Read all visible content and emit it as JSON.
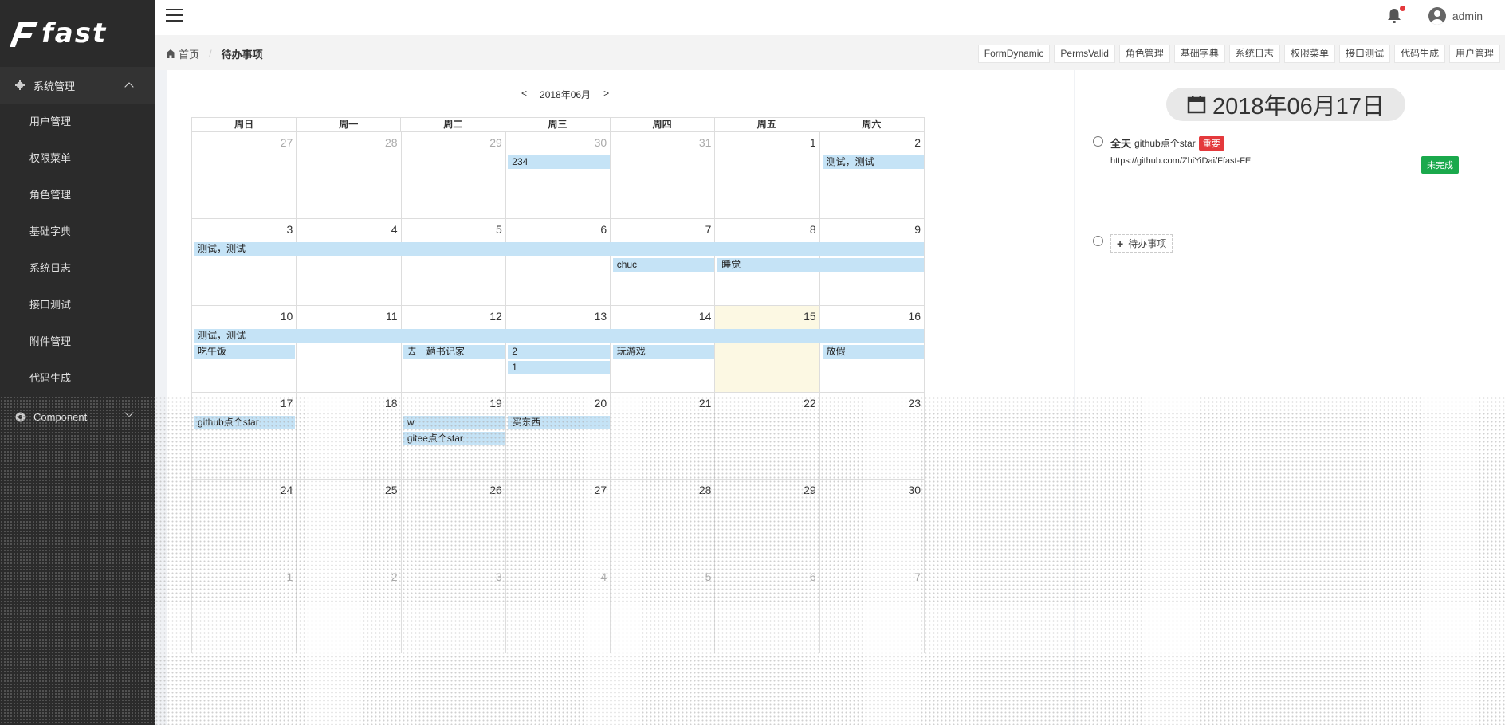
{
  "app": {
    "logo_text": "fast"
  },
  "sidebar": {
    "group1": {
      "label": "系统管理",
      "items": [
        {
          "label": "用户管理"
        },
        {
          "label": "权限菜单"
        },
        {
          "label": "角色管理"
        },
        {
          "label": "基础字典"
        },
        {
          "label": "系统日志"
        },
        {
          "label": "接口测试"
        },
        {
          "label": "附件管理"
        },
        {
          "label": "代码生成"
        }
      ]
    },
    "group2": {
      "label": "Component"
    }
  },
  "header": {
    "user": "admin",
    "has_notification": true
  },
  "breadcrumb": {
    "home": "首页",
    "separator": "/",
    "current": "待办事项"
  },
  "tags": [
    "FormDynamic",
    "PermsValid",
    "角色管理",
    "基础字典",
    "系统日志",
    "权限菜单",
    "接口测试",
    "代码生成",
    "用户管理"
  ],
  "calendar": {
    "prev": "<",
    "next": ">",
    "month_label": "2018年06月",
    "weekdays": [
      "周日",
      "周一",
      "周二",
      "周三",
      "周四",
      "周五",
      "周六"
    ],
    "weeks": [
      {
        "days": [
          {
            "n": "27",
            "other": true
          },
          {
            "n": "28",
            "other": true
          },
          {
            "n": "29",
            "other": true
          },
          {
            "n": "30",
            "other": true
          },
          {
            "n": "31",
            "other": true
          },
          {
            "n": "1"
          },
          {
            "n": "2"
          }
        ],
        "events": [
          {
            "text": "234",
            "col": 3,
            "span": 1,
            "row": 0
          },
          {
            "text": "测试，测试",
            "col": 6,
            "span": 1,
            "row": 0
          }
        ]
      },
      {
        "days": [
          {
            "n": "3"
          },
          {
            "n": "4"
          },
          {
            "n": "5"
          },
          {
            "n": "6"
          },
          {
            "n": "7"
          },
          {
            "n": "8"
          },
          {
            "n": "9"
          }
        ],
        "events": [
          {
            "text": "测试，测试",
            "col": 0,
            "span": 7,
            "row": 0
          },
          {
            "text": "chuc",
            "col": 4,
            "span": 1,
            "row": 1
          },
          {
            "text": "睡觉",
            "col": 5,
            "span": 2,
            "row": 1
          }
        ]
      },
      {
        "days": [
          {
            "n": "10"
          },
          {
            "n": "11"
          },
          {
            "n": "12"
          },
          {
            "n": "13"
          },
          {
            "n": "14"
          },
          {
            "n": "15",
            "today": true
          },
          {
            "n": "16"
          }
        ],
        "events": [
          {
            "text": "测试，测试",
            "col": 0,
            "span": 7,
            "row": 0
          },
          {
            "text": "吃午饭",
            "col": 0,
            "span": 1,
            "row": 1
          },
          {
            "text": "去一趟书记家",
            "col": 2,
            "span": 1,
            "row": 1
          },
          {
            "text": "2",
            "col": 3,
            "span": 1,
            "row": 1
          },
          {
            "text": "玩游戏",
            "col": 4,
            "span": 1,
            "row": 1
          },
          {
            "text": "放假",
            "col": 6,
            "span": 1,
            "row": 1
          },
          {
            "text": "1",
            "col": 3,
            "span": 1,
            "row": 2
          }
        ]
      },
      {
        "days": [
          {
            "n": "17"
          },
          {
            "n": "18"
          },
          {
            "n": "19"
          },
          {
            "n": "20"
          },
          {
            "n": "21"
          },
          {
            "n": "22"
          },
          {
            "n": "23"
          }
        ],
        "events": [
          {
            "text": "github点个star",
            "col": 0,
            "span": 1,
            "row": 0
          },
          {
            "text": "w",
            "col": 2,
            "span": 1,
            "row": 0
          },
          {
            "text": "买东西",
            "col": 3,
            "span": 1,
            "row": 0
          },
          {
            "text": "gitee点个star",
            "col": 2,
            "span": 1,
            "row": 1
          }
        ]
      },
      {
        "days": [
          {
            "n": "24"
          },
          {
            "n": "25"
          },
          {
            "n": "26"
          },
          {
            "n": "27"
          },
          {
            "n": "28"
          },
          {
            "n": "29"
          },
          {
            "n": "30"
          }
        ],
        "events": []
      },
      {
        "days": [
          {
            "n": "1",
            "other": true
          },
          {
            "n": "2",
            "other": true
          },
          {
            "n": "3",
            "other": true
          },
          {
            "n": "4",
            "other": true
          },
          {
            "n": "5",
            "other": true
          },
          {
            "n": "6",
            "other": true
          },
          {
            "n": "7",
            "other": true
          }
        ],
        "events": []
      }
    ]
  },
  "detail": {
    "date": "2018年06月17日",
    "item": {
      "allday": "全天",
      "title": "github点个star",
      "badge": "重要",
      "url": "https://github.com/ZhiYiDai/Ffast-FE",
      "status": "未完成"
    },
    "add_label": "待办事项"
  },
  "colors": {
    "event": "#c5e3f6",
    "today": "#fcf8e3",
    "badge": "#e4393c",
    "status": "#1aa94c",
    "sidebar": "#2b2b2b"
  }
}
